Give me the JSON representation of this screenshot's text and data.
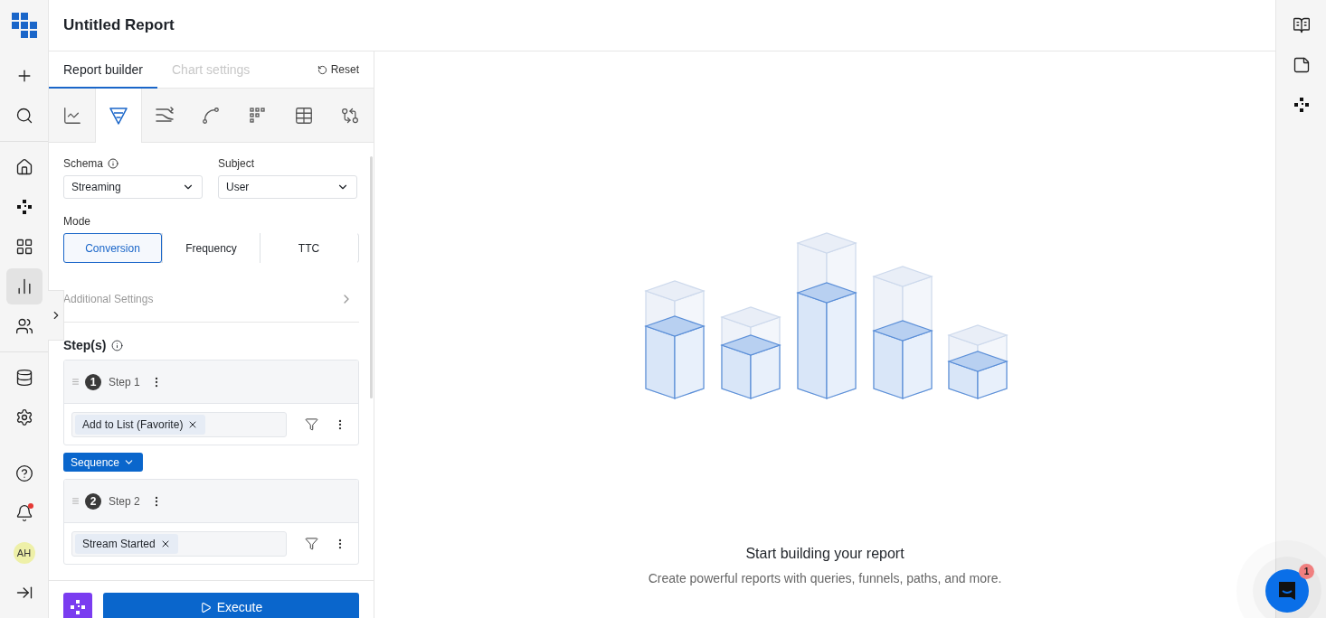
{
  "rail": {
    "items": [
      {
        "selected": false
      },
      {
        "selected": false
      },
      {
        "selected": false
      },
      {
        "selected": false
      },
      {
        "selected": false
      },
      {
        "selected": true
      },
      {
        "selected": false
      },
      {
        "selected": false
      },
      {
        "selected": false
      },
      {
        "selected": false
      }
    ],
    "notifications_unread": true,
    "avatar": "AH"
  },
  "header": {
    "title": "Untitled Report"
  },
  "panel": {
    "tabs": [
      {
        "label": "Report builder",
        "selected": true,
        "disabled": false
      },
      {
        "label": "Chart settings",
        "selected": false,
        "disabled": true
      }
    ],
    "reset": "Reset",
    "report_types": [
      {
        "selected": false
      },
      {
        "selected": true
      },
      {
        "selected": false
      },
      {
        "selected": false
      },
      {
        "selected": false
      },
      {
        "selected": false
      },
      {
        "selected": false
      }
    ],
    "schema": {
      "label": "Schema",
      "value": "Streaming"
    },
    "subject": {
      "label": "Subject",
      "value": "User"
    },
    "mode": {
      "label": "Mode",
      "options": [
        {
          "label": "Conversion",
          "selected": true
        },
        {
          "label": "Frequency",
          "selected": false
        },
        {
          "label": "TTC",
          "selected": false
        }
      ]
    },
    "additional_settings": "Additional Settings",
    "steps_title": "Step(s)",
    "steps": [
      {
        "number": "1",
        "label": "Step 1",
        "events": [
          "Add to List (Favorite)"
        ]
      },
      {
        "number": "2",
        "label": "Step 2",
        "events": [
          "Stream Started"
        ]
      }
    ],
    "connector": "Sequence",
    "execute": "Execute"
  },
  "empty_state": {
    "title": "Start building your report",
    "subtitle": "Create powerful reports with queries, funnels, paths, and more."
  },
  "chat": {
    "badge": "1"
  }
}
